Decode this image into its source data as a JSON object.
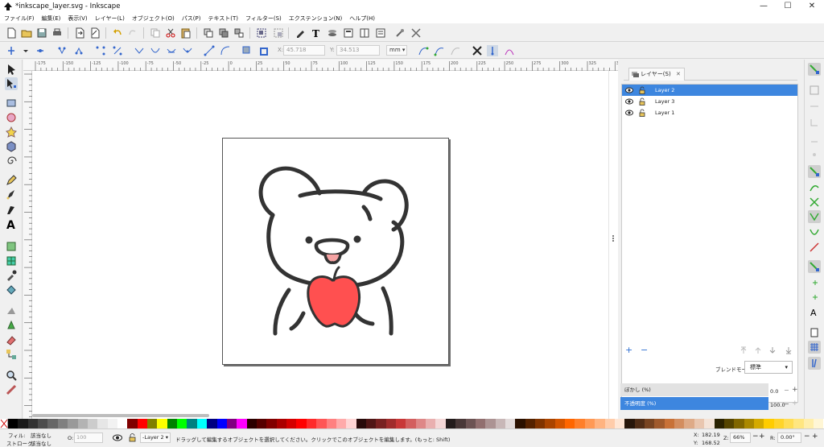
{
  "window": {
    "title": "*inkscape_layer.svg - Inkscape",
    "controls": {
      "minimize": "—",
      "maximize": "☐",
      "close": "✕"
    }
  },
  "menu": [
    "ファイル(F)",
    "編集(E)",
    "表示(V)",
    "レイヤー(L)",
    "オブジェクト(O)",
    "パス(P)",
    "テキスト(T)",
    "フィルター(S)",
    "エクステンション(N)",
    "ヘルプ(H)"
  ],
  "controls_bar": {
    "x_label": "X:",
    "x_value": "45.718",
    "y_label": "Y:",
    "y_value": "34.513",
    "unit": "mm"
  },
  "ruler_labels": [
    "-175",
    "-150",
    "-125",
    "-100",
    "-75",
    "-50",
    "-25",
    "0",
    "25",
    "50",
    "75",
    "100",
    "125",
    "150",
    "175",
    "200",
    "225",
    "250",
    "275",
    "300",
    "325",
    "350"
  ],
  "layers_panel": {
    "tab_label": "レイヤー(S)",
    "tab_close": "✕",
    "layers": [
      {
        "name": "Layer 2",
        "selected": true
      },
      {
        "name": "Layer 3",
        "selected": false
      },
      {
        "name": "Layer 1",
        "selected": false
      }
    ],
    "add": "+",
    "remove": "−",
    "blend_label": "ブレンドモード:",
    "blend_value": "標準",
    "blur_label": "ぼかし (%)",
    "blur_value": "0.0",
    "opacity_label": "不透明度 (%)",
    "opacity_value": "100.0",
    "plus": "+",
    "minus": "−"
  },
  "palette_colors": [
    "#000000",
    "#1a1a1a",
    "#333333",
    "#4d4d4d",
    "#666666",
    "#808080",
    "#999999",
    "#b3b3b3",
    "#cccccc",
    "#e6e6e6",
    "#f2f2f2",
    "#ffffff",
    "#800000",
    "#ff0000",
    "#808000",
    "#ffff00",
    "#008000",
    "#00ff00",
    "#008080",
    "#00ffff",
    "#000080",
    "#0000ff",
    "#800080",
    "#ff00ff",
    "#2b0000",
    "#550000",
    "#800000",
    "#aa0000",
    "#d40000",
    "#ff0000",
    "#ff2a2a",
    "#ff5555",
    "#ff8080",
    "#ffaaaa",
    "#ffd5d5",
    "#280b0b",
    "#501616",
    "#782121",
    "#a02c2c",
    "#c83737",
    "#d35f5f",
    "#de8787",
    "#e9afaf",
    "#f4d7d7",
    "#241c1c",
    "#483737",
    "#6c5353",
    "#916f6f",
    "#ac9393",
    "#c8b7b7",
    "#e3dbdb",
    "#2b1100",
    "#552200",
    "#803300",
    "#aa4400",
    "#d45500",
    "#ff6600",
    "#ff7f2a",
    "#ff9955",
    "#ffb380",
    "#ffccaa",
    "#ffe6d5",
    "#28170b",
    "#502d16",
    "#784421",
    "#a05a2c",
    "#c87137",
    "#d38d5f",
    "#deaa87",
    "#e9c6af",
    "#f4e3d7",
    "#2b2200",
    "#554400",
    "#806600",
    "#aa8800",
    "#d4aa00",
    "#ffcc00",
    "#ffd42a",
    "#ffdd55",
    "#ffe680",
    "#ffeeaa",
    "#fff6d5"
  ],
  "status": {
    "fill_label": "フィル:",
    "fill_value": "該当なし",
    "stroke_label": "ストローク:",
    "stroke_value": "該当なし",
    "opacity_label": "O:",
    "opacity_value": "100",
    "layer_select": "-Layer 2",
    "message": "ドラッグして編集するオブジェクトを選択してください。クリックでこのオブジェクトを編集します。(もっと: Shift)",
    "x_label": "X:",
    "x_value": "182.19",
    "y_label": "Y:",
    "y_value": "168.52",
    "zoom_label": "Z:",
    "zoom_value": "66%",
    "rotate_label": "R:",
    "rotate_value": "0.00°"
  },
  "colors": {
    "accent": "#3d86df",
    "apple": "#ff5050",
    "ink": "#333333"
  }
}
